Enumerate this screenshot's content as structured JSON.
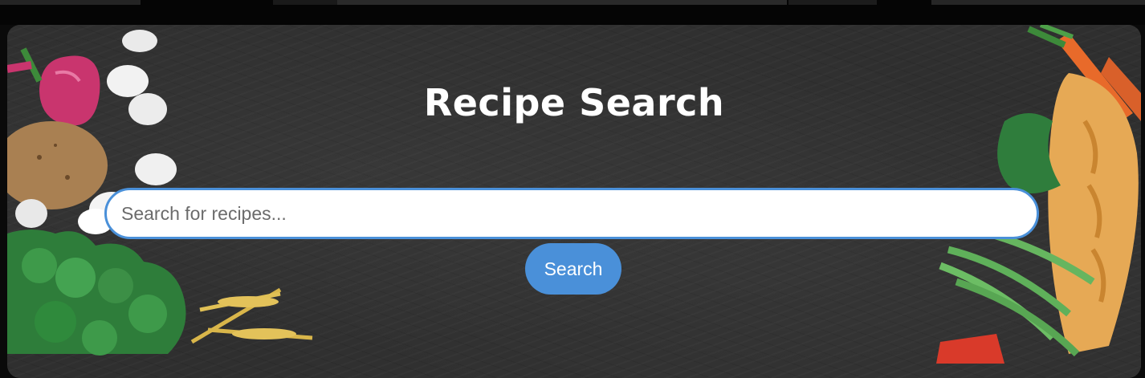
{
  "page": {
    "title": "Recipe Search"
  },
  "search": {
    "placeholder": "Search for recipes...",
    "value": "",
    "button_label": "Search"
  },
  "colors": {
    "accent": "#4a90d9",
    "title_text": "#ffffff",
    "background": "#2f2f2f"
  }
}
